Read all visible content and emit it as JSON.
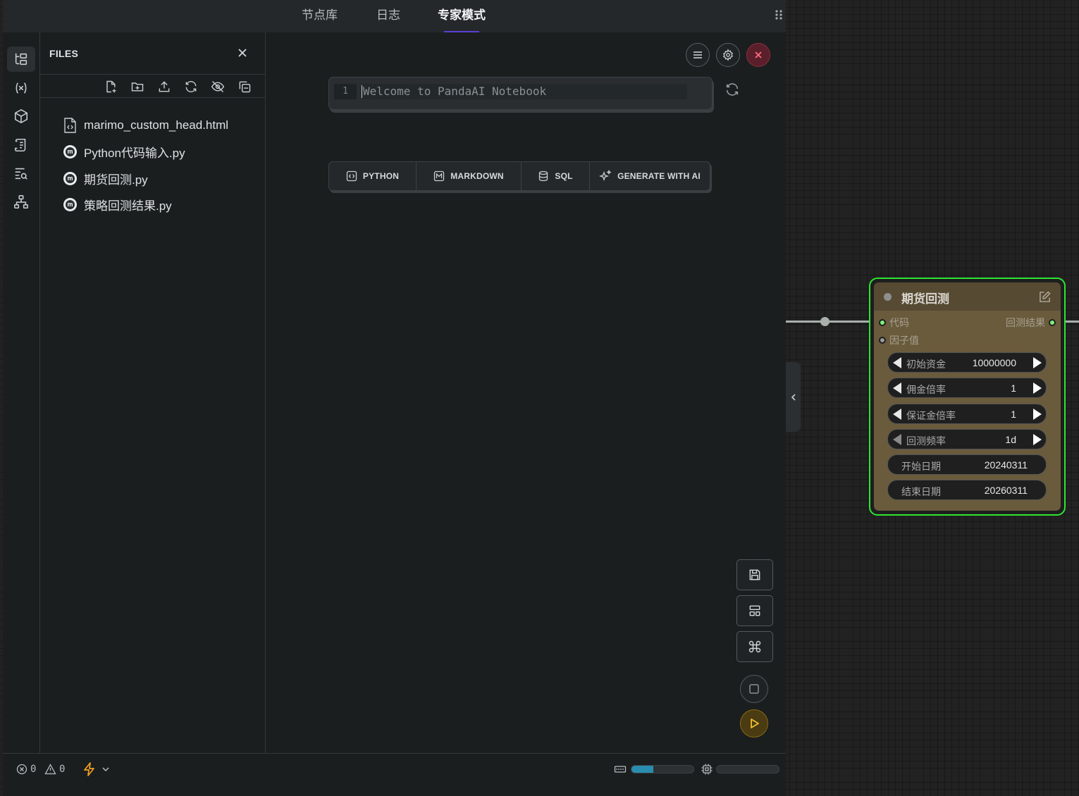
{
  "top_tabs": [
    {
      "label": "节点库",
      "active": false
    },
    {
      "label": "日志",
      "active": false
    },
    {
      "label": "专家模式",
      "active": true
    }
  ],
  "activity_bar": {
    "icons": [
      "file-tree-icon",
      "variables-icon",
      "package-icon",
      "notebook-outline-icon",
      "search-logs-icon",
      "dependency-graph-icon"
    ]
  },
  "files_panel": {
    "title": "FILES",
    "toolbar_icons": [
      "new-file-icon",
      "new-folder-icon",
      "upload-icon",
      "refresh-icon",
      "hide-icon",
      "collapse-all-icon"
    ],
    "files": [
      {
        "name": "marimo_custom_head.html",
        "icon": "html-file-icon"
      },
      {
        "name": "Python代码输入.py",
        "icon": "marimo-icon"
      },
      {
        "name": "期货回测.py",
        "icon": "marimo-icon"
      },
      {
        "name": "策略回测结果.py",
        "icon": "marimo-icon"
      }
    ]
  },
  "notebook": {
    "cell": {
      "line_number": "1",
      "text": "Welcome to PandaAI Notebook"
    },
    "add_cell_buttons": [
      {
        "label": "PYTHON",
        "icon": "python-icon"
      },
      {
        "label": "MARKDOWN",
        "icon": "markdown-icon"
      },
      {
        "label": "SQL",
        "icon": "database-icon"
      },
      {
        "label": "GENERATE WITH AI",
        "icon": "sparkle-icon"
      }
    ]
  },
  "status_bar": {
    "errors": "0",
    "warnings": "0",
    "memory_fraction": 0.35,
    "cpu_fraction": 0.0
  },
  "node": {
    "title": "期货回测",
    "inputs": [
      {
        "label": "代码",
        "connected": true
      },
      {
        "label": "因子值",
        "connected": false
      }
    ],
    "outputs": [
      {
        "label": "回测结果",
        "connected": true
      }
    ],
    "widgets": [
      {
        "label": "初始资金",
        "value": "10000000",
        "type": "number"
      },
      {
        "label": "佣金倍率",
        "value": "1",
        "type": "number"
      },
      {
        "label": "保证金倍率",
        "value": "1",
        "type": "number"
      },
      {
        "label": "回测频率",
        "value": "1d",
        "type": "combo"
      },
      {
        "label": "开始日期",
        "value": "20240311",
        "type": "text"
      },
      {
        "label": "结束日期",
        "value": "20260311",
        "type": "text"
      }
    ]
  },
  "colors": {
    "accent_purple": "#5b3fd6",
    "node_border": "#2ee62e",
    "node_body": "#6a5b3d",
    "connected_slot": "#7cf27c",
    "run_button": "#e0b020",
    "close_button": "#c0243c"
  }
}
